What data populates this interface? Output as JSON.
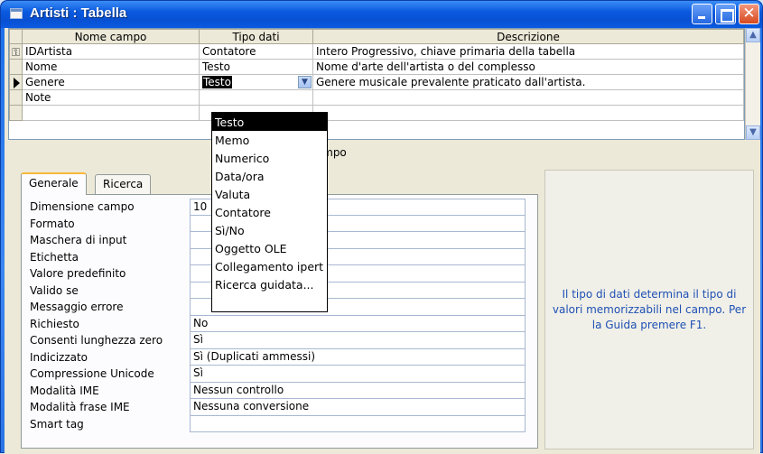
{
  "window": {
    "title": "Artisti : Tabella"
  },
  "grid": {
    "headers": [
      "Nome campo",
      "Tipo dati",
      "Descrizione"
    ],
    "rows": [
      {
        "nome": "IDArtista",
        "tipo": "Contatore",
        "descrizione": "Intero Progressivo, chiave primaria della tabella",
        "indicator": "key-icon"
      },
      {
        "nome": "Nome",
        "tipo": "Testo",
        "descrizione": "Nome d'arte dell'artista o del complesso",
        "indicator": ""
      },
      {
        "nome": "Genere",
        "tipo": "Testo",
        "descrizione": "Genere musicale prevalente praticato dall'artista.",
        "indicator": "current-row-arrow-icon"
      },
      {
        "nome": "Note",
        "tipo": "",
        "descrizione": "",
        "indicator": ""
      },
      {
        "nome": "",
        "tipo": "",
        "descrizione": "",
        "indicator": ""
      }
    ]
  },
  "properties_caption": "Proprietà campo",
  "tabs": [
    "Generale",
    "Ricerca"
  ],
  "properties": [
    {
      "label": "Dimensione campo",
      "value": "10"
    },
    {
      "label": "Formato",
      "value": ""
    },
    {
      "label": "Maschera di input",
      "value": ""
    },
    {
      "label": "Etichetta",
      "value": ""
    },
    {
      "label": "Valore predefinito",
      "value": ""
    },
    {
      "label": "Valido se",
      "value": ""
    },
    {
      "label": "Messaggio errore",
      "value": ""
    },
    {
      "label": "Richiesto",
      "value": "No"
    },
    {
      "label": "Consenti lunghezza zero",
      "value": "Sì"
    },
    {
      "label": "Indicizzato",
      "value": "Sì (Duplicati ammessi)"
    },
    {
      "label": "Compressione Unicode",
      "value": "Sì"
    },
    {
      "label": "Modalità IME",
      "value": "Nessun controllo"
    },
    {
      "label": "Modalità frase IME",
      "value": "Nessuna conversione"
    },
    {
      "label": "Smart tag",
      "value": ""
    }
  ],
  "dropdown": {
    "selected": "Testo",
    "options": [
      "Testo",
      "Memo",
      "Numerico",
      "Data/ora",
      "Valuta",
      "Contatore",
      "Sì/No",
      "Oggetto OLE",
      "Collegamento ipert",
      "Ricerca guidata..."
    ]
  },
  "help_text": "Il tipo di dati determina il tipo di valori memorizzabili nel campo. Per la Guida premere F1.",
  "colors": {
    "titlebar": "#0a5ae0",
    "help_text": "#1e50b4",
    "tab_highlight": "#f9b83a"
  }
}
